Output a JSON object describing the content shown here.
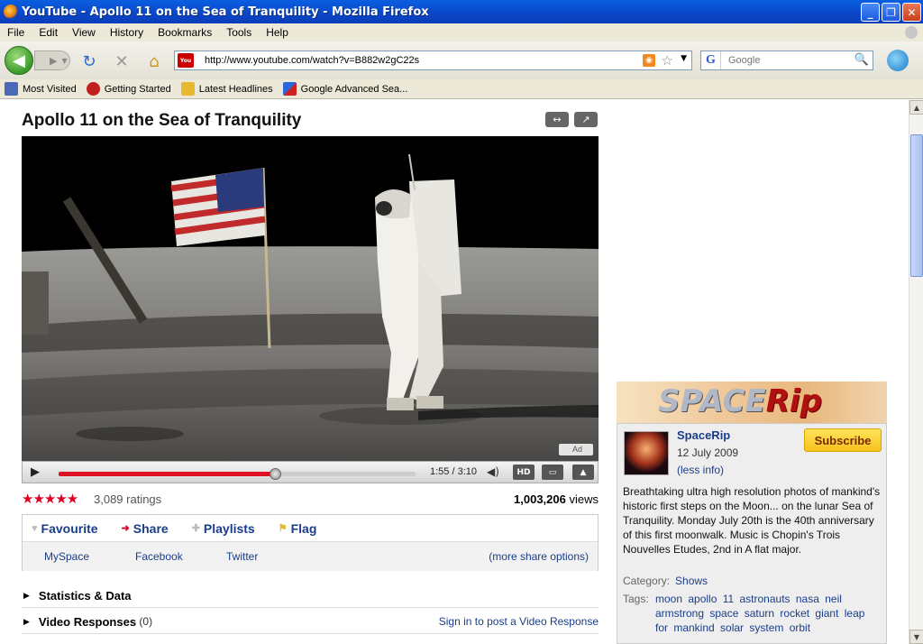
{
  "window": {
    "title": "YouTube - Apollo 11 on the Sea of Tranquility - Mozilla Firefox"
  },
  "menu": [
    "File",
    "Edit",
    "View",
    "History",
    "Bookmarks",
    "Tools",
    "Help"
  ],
  "nav": {
    "url": "http://www.youtube.com/watch?v=B882w2gC22s",
    "search_placeholder": "Google"
  },
  "bookmarks": [
    "Most Visited",
    "Getting Started",
    "Latest Headlines",
    "Google Advanced Sea..."
  ],
  "video": {
    "title": "Apollo 11 on the Sea of Tranquility",
    "time": "1:55 / 3:10",
    "progress_fraction": 0.605,
    "hd_label": "HD",
    "ad_badge": "Ad"
  },
  "stats": {
    "stars": "★★★★★",
    "ratings": "3,089 ratings",
    "views_count": "1,003,206",
    "views_label": "views"
  },
  "actions": {
    "favourite": "Favourite",
    "share": "Share",
    "playlists": "Playlists",
    "flag": "Flag",
    "myspace": "MySpace",
    "facebook": "Facebook",
    "twitter": "Twitter",
    "more_share": "(more share options)"
  },
  "sections": {
    "statistics": "Statistics & Data",
    "responses": "Video Responses",
    "responses_count": "(0)",
    "sign_in_response": "Sign in to post a Video Response"
  },
  "channel": {
    "ad_logo_a": "SPACE",
    "ad_logo_b": "Rip",
    "name": "SpaceRip",
    "date": "12 July 2009",
    "less_info": "(less info)",
    "subscribe": "Subscribe",
    "description": "Breathtaking ultra high resolution photos of mankind's historic first steps on the Moon... on the lunar Sea of Tranquility. Monday July 20th is the 40th anniversary of this first moonwalk. Music is Chopin's Trois Nouvelles Etudes, 2nd in A flat major.",
    "category_label": "Category:",
    "category": "Shows",
    "tags_label": "Tags:",
    "tags": "moon apollo 11 astronauts nasa neil armstrong space saturn rocket giant leap for mankind solar system orbit"
  }
}
